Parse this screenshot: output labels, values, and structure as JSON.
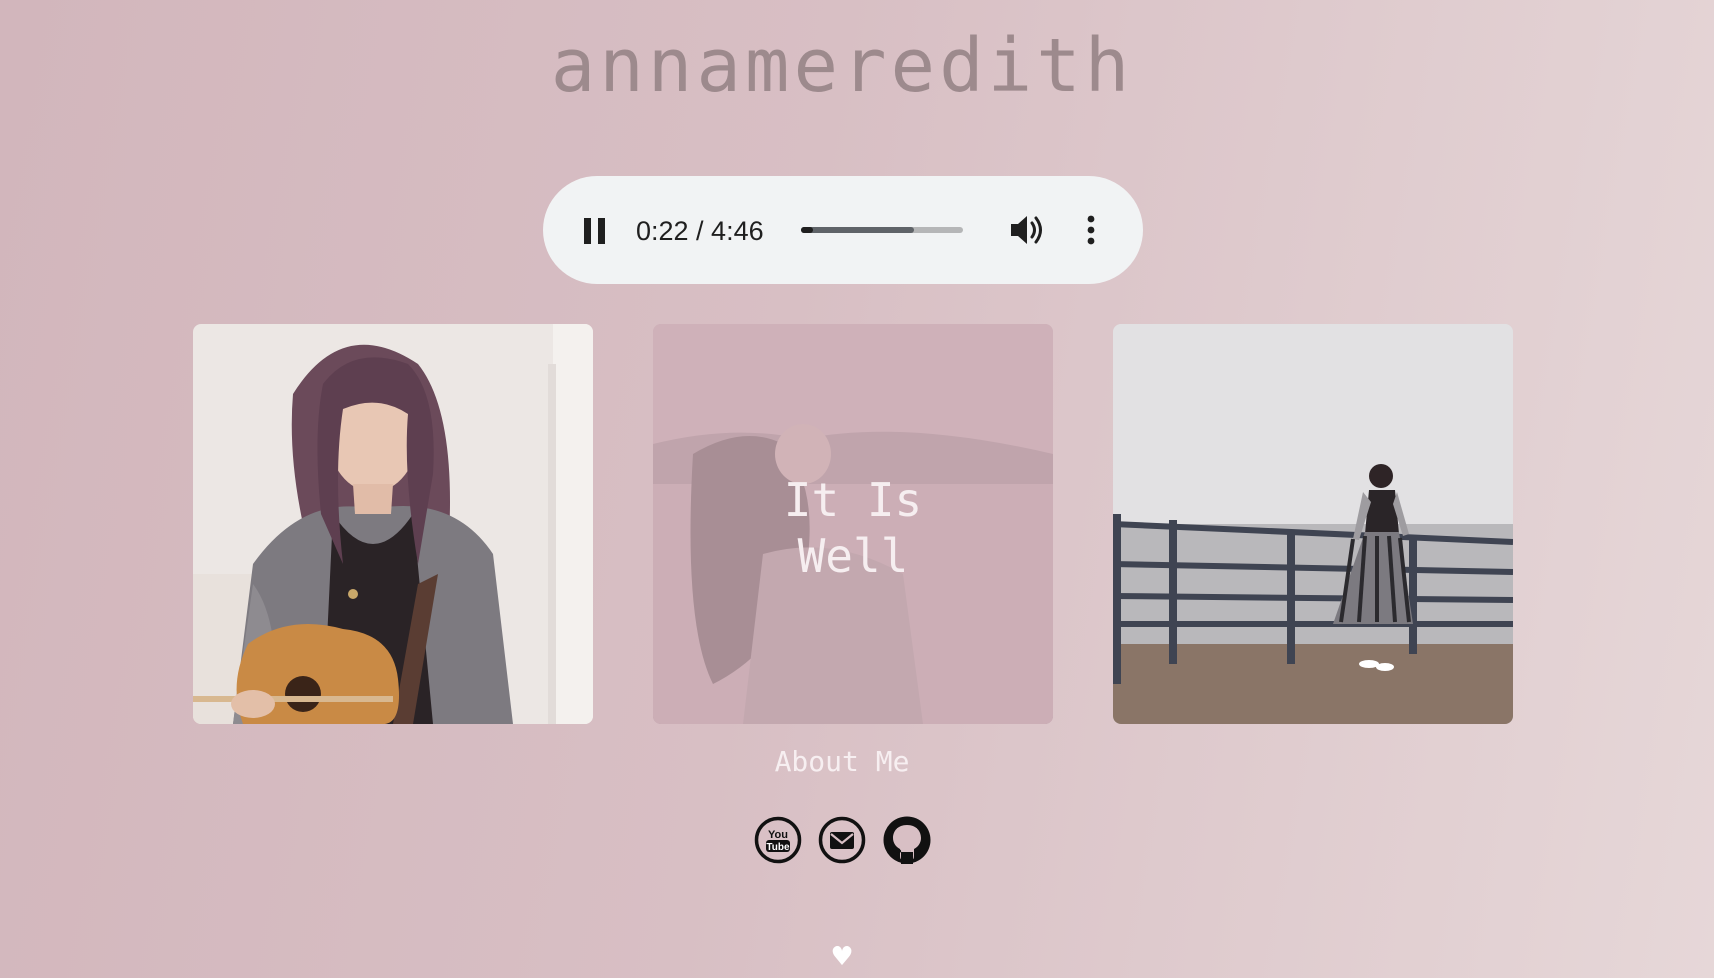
{
  "site": {
    "title": "annameredith"
  },
  "player": {
    "state": "playing",
    "pause_icon": "pause-icon",
    "time_display": "0:22 / 4:46",
    "progress_fraction": 0.077,
    "buffered_fraction": 0.7,
    "volume_icon": "volume-icon",
    "menu_icon": "more-vert-icon"
  },
  "gallery": {
    "cards": [
      {
        "photo": "guitar-portrait-photo"
      },
      {
        "photo": "lake-photo",
        "caption": "It Is\nWell"
      },
      {
        "photo": "pier-photo"
      }
    ]
  },
  "about": {
    "label": "About Me"
  },
  "social": {
    "youtube_text_top": "You",
    "youtube_text_bottom": "Tube",
    "icons": [
      "youtube-icon",
      "mail-icon",
      "github-icon"
    ]
  },
  "footer": {
    "heart": "♥"
  },
  "colors": {
    "background": "#d8bfc4",
    "title": "#9d8a8d",
    "player_bg": "#f1f3f4"
  }
}
